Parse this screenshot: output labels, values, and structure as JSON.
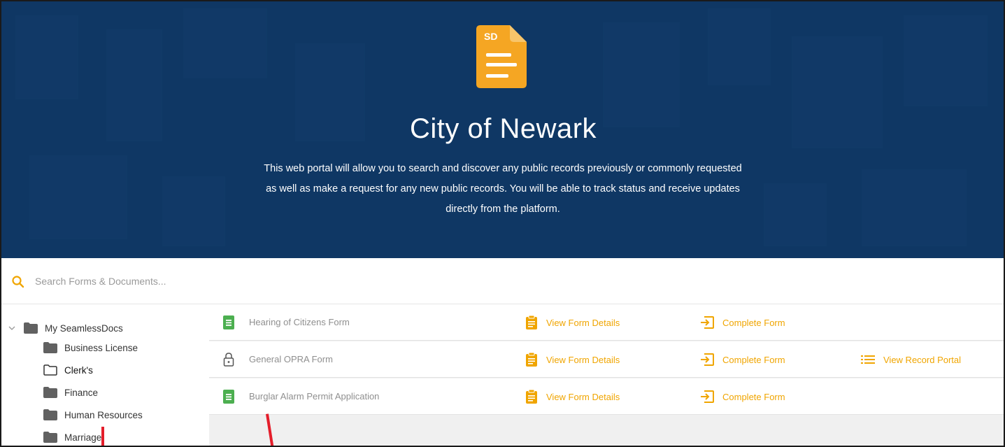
{
  "hero": {
    "logo_text": "SD",
    "title": "City of Newark",
    "description": "This web portal will allow you to search and discover any public records previously or commonly requested as well as make a request for any new public records. You will be able to track status and receive updates directly from the platform."
  },
  "search": {
    "placeholder": "Search Forms & Documents...",
    "value": ""
  },
  "sidebar": {
    "root": {
      "label": "My SeamlessDocs",
      "expanded": true
    },
    "items": [
      {
        "label": "Business License",
        "icon": "folder-filled-icon"
      },
      {
        "label": "Clerk's",
        "icon": "folder-outline-icon"
      },
      {
        "label": "Finance",
        "icon": "folder-filled-icon"
      },
      {
        "label": "Human Resources",
        "icon": "folder-filled-icon"
      },
      {
        "label": "Marriage",
        "icon": "folder-filled-icon"
      }
    ]
  },
  "forms": [
    {
      "name": "Hearing of Citizens Form",
      "icon": "document-icon",
      "details": "View Form Details",
      "complete": "Complete Form",
      "portal": ""
    },
    {
      "name": "General OPRA Form",
      "icon": "lock-icon",
      "details": "View Form Details",
      "complete": "Complete Form",
      "portal": "View Record Portal"
    },
    {
      "name": "Burglar Alarm Permit Application",
      "icon": "document-icon",
      "details": "View Form Details",
      "complete": "Complete Form",
      "portal": ""
    }
  ],
  "colors": {
    "hero_bg": "#0f3764",
    "accent": "#f0a500",
    "doc_green": "#4caf50",
    "annotation": "#e41e2b"
  }
}
